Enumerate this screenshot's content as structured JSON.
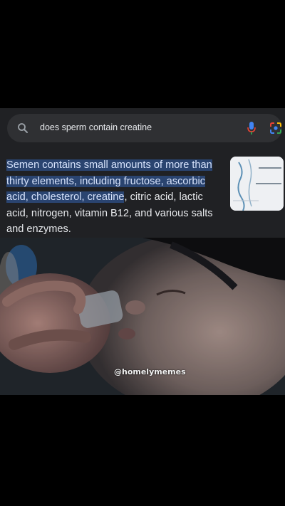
{
  "search": {
    "query": "does sperm contain creatine",
    "search_icon": "search-icon",
    "mic_icon": "mic-icon",
    "lens_icon": "google-lens-icon"
  },
  "snippet": {
    "highlighted": "Semen contains small amounts of more than thirty elements, including fructose, ascorbic acid, cholesterol, creatine",
    "rest": ", citric acid, lactic acid, nitrogen, vitamin B12, and various salts and enzymes."
  },
  "photo": {
    "watermark": "@homelymemes"
  },
  "colors": {
    "highlight": "#2a4470",
    "panel": "#202124",
    "search_bar": "#2f3033"
  }
}
